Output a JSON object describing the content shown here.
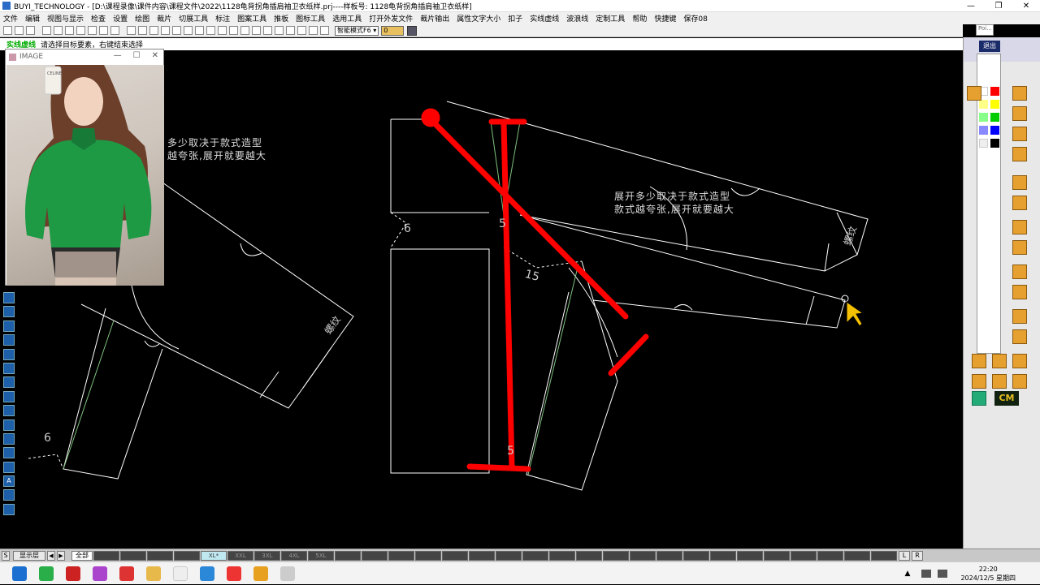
{
  "window": {
    "app_name": "BUYI_TECHNOLOGY",
    "title": "BUYI_TECHNOLOGY - [D:\\课程录像\\课件内容\\课程文件\\2022\\1128龟背拐角插肩袖卫衣纸样.prj----样板号: 1128龟背拐角插肩袖卫衣纸样]",
    "controls": [
      "—",
      "❐",
      "✕"
    ]
  },
  "menu": [
    "文件",
    "编辑",
    "视图与显示",
    "检查",
    "设置",
    "绘图",
    "裁片",
    "切展工具",
    "标注",
    "图案工具",
    "推板",
    "图标工具",
    "选用工具",
    "打开外发文件",
    "裁片输出",
    "属性文字大小",
    "扣子",
    "实线虚线",
    "波浪线",
    "定制工具",
    "帮助",
    "快捷键",
    "保存08"
  ],
  "toolbar": {
    "mode_select": "智能模式F6 ▾",
    "mode_value": "0"
  },
  "status": {
    "mode": "实线虚线",
    "hint": "请选择目标要素，右键结束选择"
  },
  "image_window": {
    "title": "IMAGE",
    "controls": [
      "—",
      "☐",
      "✕"
    ],
    "phone_brand": "CELINE"
  },
  "canvas": {
    "annotation_left": [
      "多少取决于款式造型",
      "越夸张,展开就要越大"
    ],
    "annotation_right": [
      "展开多少取决于款式造型",
      "款式越夸张,展开就要越大"
    ],
    "cuff_label": "螺纹",
    "numbers": [
      "6",
      "15",
      "5",
      "6",
      "5"
    ]
  },
  "right_panel": {
    "exit_label": "退出",
    "cm_label": "CM",
    "poi_label": "Poi..."
  },
  "bottom": {
    "s_label": "S",
    "layer_label": "显示层",
    "all_label": "全部",
    "sizes": [
      "XL*",
      "XXL",
      "3XL",
      "4XL",
      "5XL"
    ],
    "l_label": "L",
    "r_label": "R"
  },
  "taskbar": {
    "time": "22:20",
    "date": "2024/12/5 星期四"
  },
  "colors": {
    "canvas_bg": "#000000",
    "pattern_line": "#ffffff",
    "guide_line": "#7fc07f",
    "highlight": "#ff0000"
  }
}
